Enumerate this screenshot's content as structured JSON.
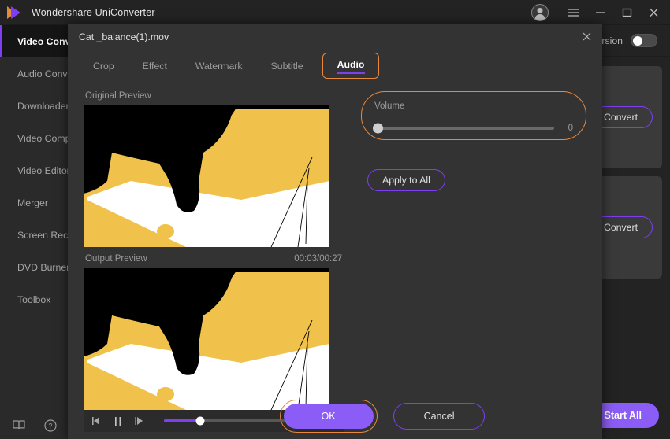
{
  "window": {
    "app_title": "Wondershare UniConverter",
    "logo_icon": "play-logo-icon",
    "controls": {
      "avatar": "user-avatar-icon",
      "menu": "hamburger-menu-icon",
      "minimize": "minimize-icon",
      "maximize": "maximize-icon",
      "close": "close-icon"
    },
    "colors": {
      "accent_purple": "#7e3ff2",
      "button_purple": "#8b5cf6",
      "highlight_orange": "#e8883a",
      "dialog_bg": "#333333",
      "sidebar_bg": "#2a2a2a",
      "window_bg": "#232323"
    }
  },
  "sidebar": {
    "items": [
      {
        "label": "Video Conv",
        "active": true
      },
      {
        "label": "Audio Conve",
        "active": false
      },
      {
        "label": "Downloader",
        "active": false
      },
      {
        "label": "Video Comp",
        "active": false
      },
      {
        "label": "Video Editor",
        "active": false
      },
      {
        "label": "Merger",
        "active": false
      },
      {
        "label": "Screen Reco",
        "active": false
      },
      {
        "label": "DVD Burner",
        "active": false
      },
      {
        "label": "Toolbox",
        "active": false
      }
    ],
    "bottom_icons": [
      "manual-book-icon",
      "help-question-icon"
    ]
  },
  "main": {
    "conversion_label": "Conversion",
    "conversion_toggle_on": false,
    "convert_button_1": "Convert",
    "convert_button_2": "Convert",
    "start_all_label": "Start All"
  },
  "dialog": {
    "title": "Cat _balance(1).mov",
    "close_icon": "close-icon",
    "tabs": [
      {
        "label": "Crop",
        "active": false
      },
      {
        "label": "Effect",
        "active": false
      },
      {
        "label": "Watermark",
        "active": false
      },
      {
        "label": "Subtitle",
        "active": false
      },
      {
        "label": "Audio",
        "active": true
      }
    ],
    "original_preview_label": "Original Preview",
    "output_preview_label": "Output Preview",
    "time_display": "00:03/00:27",
    "playback": {
      "prev_frame_icon": "previous-frame-icon",
      "pause_icon": "pause-icon",
      "next_frame_icon": "next-frame-icon",
      "progress_percent": 22
    },
    "volume": {
      "label": "Volume",
      "value": "0",
      "percent": 0
    },
    "apply_to_all_label": "Apply to All",
    "ok_label": "OK",
    "cancel_label": "Cancel"
  }
}
